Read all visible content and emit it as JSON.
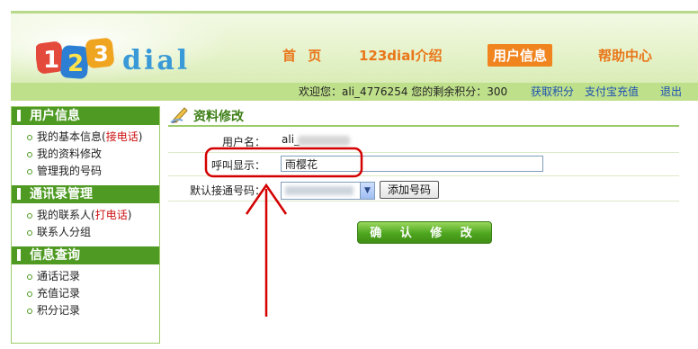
{
  "header": {
    "logo_text": "123dial",
    "nav": {
      "home": "首 页",
      "intro": "123dial介绍",
      "user_info": "用户信息",
      "help": "帮助中心"
    }
  },
  "welcome_bar": {
    "welcome": "欢迎您：ali_4776254  您的剩余积分：300",
    "get_points": "获取积分",
    "alipay": "支付宝充值",
    "logout": "退出"
  },
  "sidebar": {
    "sections": [
      {
        "title": "用户信息",
        "items": [
          {
            "label": "我的基本信息(",
            "red": "接电话",
            "tail": ")"
          },
          {
            "label": "我的资料修改"
          },
          {
            "label": "管理我的号码"
          }
        ]
      },
      {
        "title": "通讯录管理",
        "items": [
          {
            "label": "我的联系人(",
            "red": "打电话",
            "tail": ")"
          },
          {
            "label": "联系人分组"
          }
        ]
      },
      {
        "title": "信息查询",
        "items": [
          {
            "label": "通话记录"
          },
          {
            "label": "充值记录"
          },
          {
            "label": "积分记录"
          }
        ]
      }
    ]
  },
  "content": {
    "title": "资料修改",
    "username_label": "用户名：",
    "username_value": "ali_",
    "caller_display_label": "呼叫显示：",
    "caller_display_value": "雨樱花",
    "default_number_label": "默认接通号码：",
    "add_number_button": "添加号码",
    "confirm_button": "确 认 修 改"
  },
  "colors": {
    "accent_green": "#4e9a22",
    "nav_orange": "#e9761a",
    "annotation_red": "#d40000",
    "link_blue": "#1a4fb0"
  }
}
